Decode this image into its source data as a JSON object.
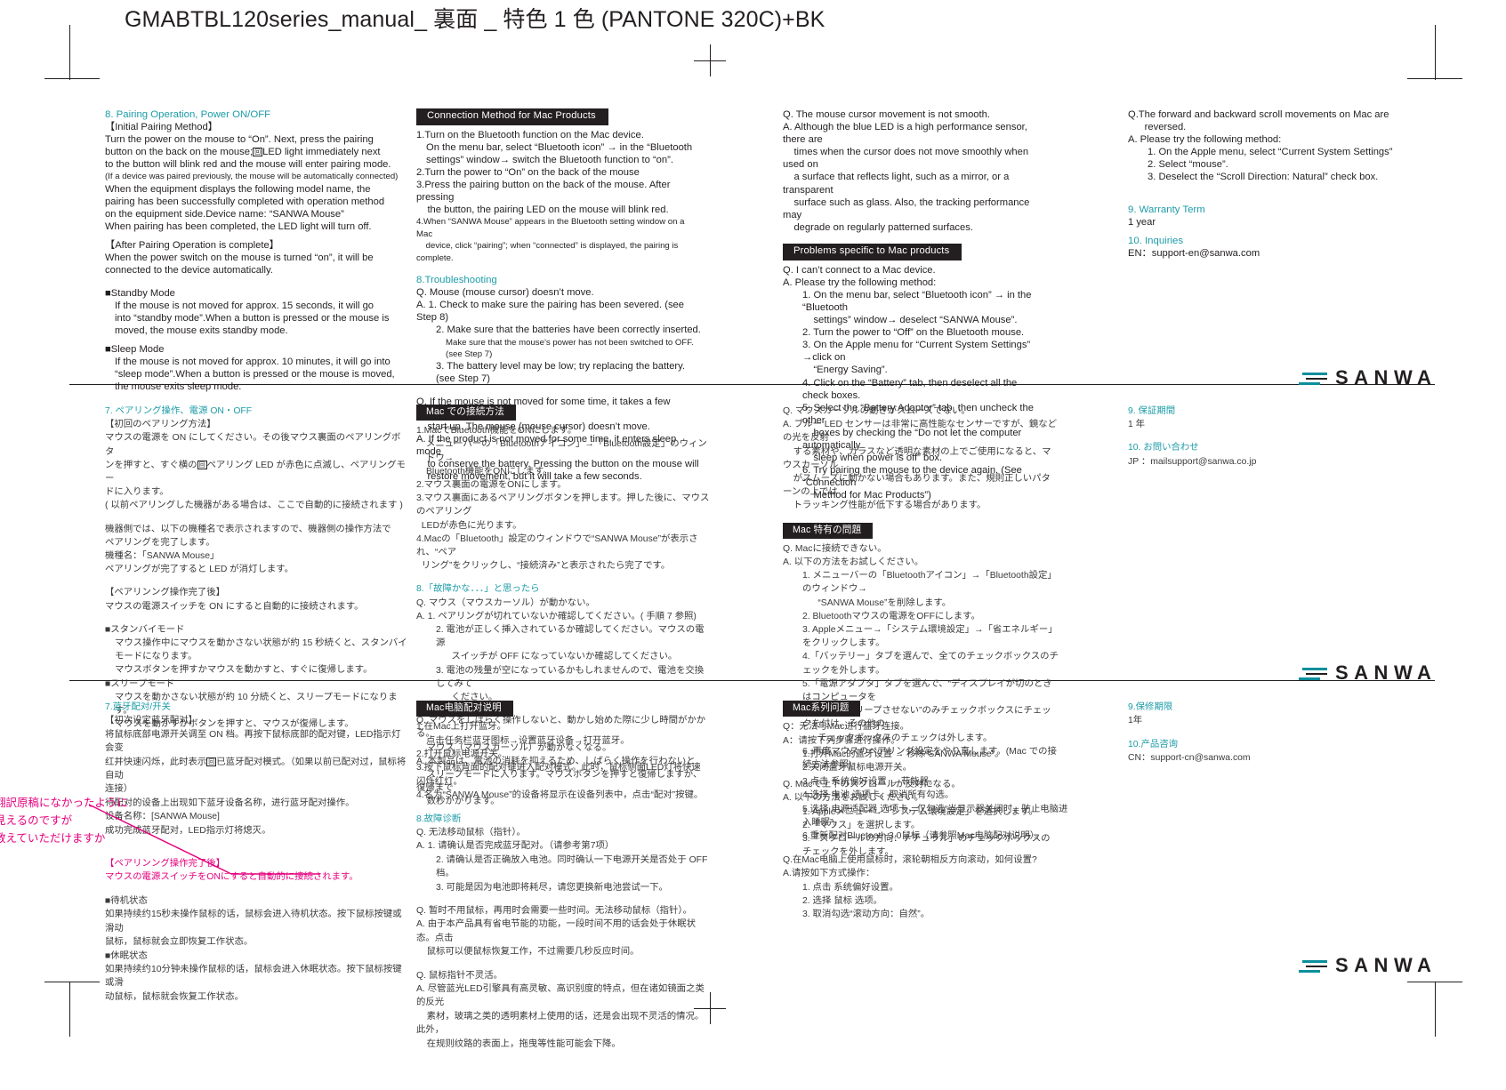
{
  "page": {
    "title": "GMABTBL120series_manual_ 裏面 _ 特色 1 色 (PANTONE 320C)+BK",
    "accent_teal": "#1d9ca8",
    "accent_pink": "#e5007e",
    "ink_black": "#231f20"
  },
  "logo": {
    "word": "SANWA",
    "mark": "sanwa-bars-mark"
  },
  "english": {
    "col1": {
      "heading": "8. Pairing Operation, Power ON/OFF",
      "sub1": "【Initial Pairing Method】",
      "p1_a": "Turn the power on the mouse to “On”. Next, press the pairing\nbutton on the back on the mouse;",
      "p1_glyph": "回",
      "p1_b": "LED light immediately next\nto the button will blink red and the mouse will enter pairing mode.",
      "p1_small": "(If a device was paired previously, the mouse will be automatically connected)",
      "p1_c": "When the equipment displays the following model name, the\npairing has been successfully completed with operation method\non the equipment side.Device name: “SANWA Mouse”\nWhen pairing has been completed, the LED light will turn off.",
      "sub2": "【After Pairing Operation is complete】",
      "p2": "When the power switch on the mouse is turned “on”, it will be\nconnected to the device automatically.",
      "standby_head": "■Standby Mode",
      "standby_body": "If the mouse is not moved for approx. 15 seconds, it will go\ninto “standby mode”.When a button is pressed or the mouse is\nmoved, the mouse exits standby mode.",
      "sleep_head": "■Sleep Mode",
      "sleep_body": "If the mouse is not moved for approx. 10 minutes, it will go into\n“sleep mode”.When a button is pressed or the mouse is moved,\nthe mouse exits sleep mode."
    },
    "col2": {
      "bar": "Connection Method for Mac Products",
      "step1": "1.Turn on the Bluetooth function on the Mac device.",
      "step1b": "On the menu bar, select “Bluetooth icon” → in the “Bluetooth\nsettings” window→ switch the Bluetooth function to “on”.",
      "step2": "2.Turn the power to “On” on the back of the mouse",
      "step3": "3.Press the pairing button on the back of the mouse. After pressing\n    the button, the pairing LED on the mouse will blink red.",
      "step4": "4.When “SANWA Mouse” appears in the Bluetooth setting window on a Mac\n    device, click “pairing”; when “connected” is displayed, the pairing is complete.",
      "heading2": "8.Troubleshooting",
      "q1": "Q. Mouse (mouse cursor) doesn’t move.",
      "a1_1": "A. 1. Check to make sure the pairing has been severed. (see Step 8)",
      "a1_2": "2. Make sure that the batteries have been correctly inserted.",
      "a1_2b": "Make sure that the mouse’s power has not been switched to OFF. (see Step 7)",
      "a1_3": "3. The battery level may be low; try replacing the battery. (see Step 7)",
      "q2": "Q. If the mouse is not moved for some time, it takes a few moments to\n    start up. The mouse (mouse cursor) doesn’t move.",
      "a2": "A. If the product is not moved for some time, it enters sleep mode\n    to conserve the battery. Pressing the button on the mouse will\n    restore movement, but it will take a few seconds."
    },
    "col3": {
      "q1": "Q. The mouse cursor movement is not smooth.",
      "a1": "A. Although the blue LED is a high performance sensor, there are\n    times when the cursor does not move smoothly when used on\n    a surface that reflects light, such as a mirror, or a transparent\n    surface such as glass. Also, the tracking performance may\n    degrade on regularly patterned surfaces.",
      "bar": "Problems specific to Mac products",
      "q2": "Q. I can’t connect to a Mac device.",
      "a2": "A. Please try the following method:",
      "a2_1": "1. On the menu bar, select “Bluetooth icon” → in the “Bluetooth\n    settings” window→ deselect “SANWA Mouse”.",
      "a2_2": "2. Turn the power to “Off” on the Bluetooth mouse.",
      "a2_3": "3. On the Apple menu for “Current System Settings” →click on\n    “Energy Saving”.",
      "a2_4": "4. Click on the “Battery” tab, then deselect all the check boxes.",
      "a2_5": "5. Select the “Battery Adaptor” tab, then uncheck the other\n    boxes by checking the “Do not let the computer automatically\n    sleep when power is off” box.",
      "a2_6": "6. Try pairing the mouse to the device again. (See “Connection\n    Method for Mac Products”)"
    },
    "col4": {
      "q1": "Q.The forward and backward scroll movements on Mac are\n      reversed.",
      "a1": "A. Please try the following method:",
      "a1_1": "1. On the Apple menu, select “Current System Settings”",
      "a1_2": "2. Select “mouse”.",
      "a1_3": "3. Deselect the “Scroll Direction: Natural” check box.",
      "warranty_head": "9. Warranty Term",
      "warranty_body": "1 year",
      "inquiries_head": "10. Inquiries",
      "inquiries_body": "EN：support-en@sanwa.com"
    }
  },
  "japanese": {
    "col1": {
      "heading": "7. ペアリング操作、電源 ON・OFF",
      "sub1": "【初回のペアリング方法】",
      "p1_a": "マウスの電源を ON にしてください。その後マウス裏面のペアリングボタ\nンを押すと、すぐ横の",
      "p1_glyph": "回",
      "p1_b": "ペアリング LED が赤色に点滅し、ペアリングモー\nドに入ります。",
      "p1_c": "( 以前ペアリングした機器がある場合は、ここで自動的に接続されます )",
      "p2": "機器側では、以下の機種名で表示されますので、機器側の操作方法で\nペアリングを完了します。\n機種名：「SANWA Mouse」\nペアリングが完了すると LED が消灯します。",
      "sub2": "【ペアリンング操作完了後】",
      "p3": "マウスの電源スイッチを ON にすると自動的に接続されます。",
      "standby_head": "■スタンバイモード",
      "standby_body": "マウス操作中にマウスを動かさない状態が約 15 秒続くと、スタンバイ\nモードになります。\nマウスボタンを押すかマウスを動かすと、すぐに復帰します。",
      "sleep_head": "■スリープモード",
      "sleep_body": "マウスを動かさない状態が約 10 分続くと、スリープモードになります。\nマウスを動かすかボタンを押すと、マウスが復帰します。"
    },
    "col2": {
      "bar": "Mac での接続方法",
      "step1": "1.MacでBluetooth機能をONにします。",
      "step1b": "メニューバーの「Bluetoothアイコン」→「Bluetooth設定」のウィンドウ→\nBluetooth機能をONにします。",
      "step2": "2.マウス裏面の電源をONにします。",
      "step3": "3.マウス裏面にあるペアリングボタンを押します。押した後に、マウスのペアリング\n  LEDが赤色に光ります。",
      "step4": "4.Macの「Bluetooth」設定のウィンドウで“SANWA Mouse”が表示され、“ペア\n  リング”をクリックし、“接続済み”と表示されたら完了です。",
      "heading2": "8.「故障かな．．．」と思ったら",
      "q1": "Q. マウス（マウスカーソル）が動かない。",
      "a1_1": "A. 1. ペアリングが切れていないか確認してください。( 手順 7 参照)",
      "a1_2": "2. 電池が正しく挿入されているか確認してください。マウスの電源\n      スイッチが OFF になっていないか確認してください。",
      "a1_3": "3. 電池の残量が空になっているかもしれませんので、電池を交換してみて\n      ください。",
      "q2": "Q. マウスをしばらく操作しないと、動かし始めた際に少し時間がかかる。\n    マウス（マウスカーソル）が動かなくなる。",
      "a2": "A. 本製品は、電池の消耗を抑えるため、しばらく操作を行わないと\n    スリープモードに入ります。マウスボタンを押すと復帰しますが、復帰まで\n    数秒かかります。"
    },
    "col3": {
      "q1": "Q. マウスカーソルの動きがスムーズでない。",
      "a1": "A. ブルー LED センサーは非常に高性能なセンサーですが、鏡などの光を反射\n    する素材や、ガラスなど透明な素材の上でご使用になると、マウスカーソル\n    がスムーズに動かない場合もあります。また、規則正しいパターンの上では\n    トラッキング性能が低下する場合があります。",
      "bar": "Mac 特有の問題",
      "q2": "Q. Macに接続できない。",
      "a2": "A. 以下の方法をお試しください。",
      "a2_1": "1. メニューバーの「Bluetoothアイコン」→「Bluetooth設定」のウィンドウ→\n      “SANWA Mouse”を削除します。",
      "a2_2": "2. Bluetoothマウスの電源をOFFにします。",
      "a2_3": "3. Appleメニュー→「システム環境設定」→「省エネルギー」をクリックします。",
      "a2_4": "4.「バッテリー」タブを選んで、全てのチェックボックスのチェックを外します。",
      "a2_5": "5.「電源アダプタ」タブを選んで、“ディスプレイが切のときはコンピュータを\n      自動でスリープさせない”のみチェックボックスにチェックを付け、その他の\n      チェックボックスのチェックは外します。",
      "a2_6": "6. 再度マウスのペアリング設定をやり直します。(Mac での接続方法参照)",
      "q3": "Q. Macで上下のスクロールが反対になる。",
      "a3": "A. 以下の方法をお試しください。",
      "a3_1": "1. Appleメニュー→「システム環境設定」を選択します。",
      "a3_2": "2.「マウス」を選択します。",
      "a3_3": "3.「スクロールの方向：ナチュラル」のチェックボックスのチェックを外します。"
    },
    "col4": {
      "warranty_head": "9. 保証期間",
      "warranty_body": "1 年",
      "inquiries_head": "10. お問い合わせ",
      "inquiries_body": "JP ：mailsupport@sanwa.co.jp"
    }
  },
  "chinese": {
    "col1": {
      "heading": "7.蓝牙配对/开关",
      "sub1": "【初次设定蓝牙配对】",
      "p1_a": "将鼠标底部电源开关调至 ON 档。再按下鼠标底部的配对键，LED指示灯会变\n红并快速闪烁，此时表示",
      "p1_glyph": "回",
      "p1_b": "已蓝牙配对模式。（如果以前已配对过，鼠标将自动\n连接）",
      "p1_c": "待配对的设备上出现如下蓝牙设备名称，进行蓝牙配对操作。\n设备名称：[SANWA Mouse]\n成功完成蓝牙配对，LED指示灯将熄灭。",
      "pink_head": "【ペアリンング操作完了後】",
      "pink_body": "マウスの電源スイッチをONにすると自動的に接続されます。",
      "standby_head": "■待机状态",
      "standby_body": "如果持续约15秒未操作鼠标的话，鼠标会进入待机状态。按下鼠标按键或滑动\n鼠标，鼠标就会立即恢复工作状态。",
      "sleep_head": "■休眠状态",
      "sleep_body": "如果持续约10分钟未操作鼠标的话，鼠标会进入休眠状态。按下鼠标按键或滑\n动鼠标，鼠标就会恢复工作状态。"
    },
    "col2": {
      "bar": "Mac电脑配对说明",
      "step1": "1.在Mac上打开蓝牙。",
      "step1b": "点击任务栏蓝牙图标→设置蓝牙设备→打开蓝牙。",
      "step2": "2.打开鼠标电源开关。",
      "step3": "3.按下鼠标背面的配对键进入配对模式。此时，鼠标侧面LED灯将快速闪烁红灯。",
      "step4": "4.名为“SANWA Mouse”的设备将显示在设备列表中，点击“配对”按键。",
      "heading2": "8.故障诊断",
      "q1": "Q. 无法移动鼠标（指针）。",
      "a1_1": "A. 1. 请确认是否完成蓝牙配对。（请参考第7项）",
      "a1_2": "2. 请确认是否正确放入电池。同时确认一下电源开关是否处于 OFF 档。",
      "a1_3": "3. 可能是因为电池即将耗尽，请您更换新电池尝试一下。",
      "q2": "Q. 暂时不用鼠标，再用时会需要一些时间。无法移动鼠标（指针）。",
      "a2": "A. 由于本产品具有省电节能的功能，一段时间不用的话会处于休眠状态。点击\n    鼠标可以便鼠标恢复工作，不过需要几秒反应时间。",
      "q3": "Q. 鼠标指针不灵活。",
      "a3": "A. 尽管蓝光LED引擎具有高灵敏、高识别度的特点，但在诸如镜面之类的反光\n    素材，玻璃之类的透明素材上使用的话，还是会出现不灵活的情况。此外，\n    在规则纹路的表面上，拖曳等性能可能会下降。"
    },
    "col3": {
      "bar": "Mac系列问题",
      "q1": "Q：无法与Mac进行蓝牙连接。",
      "a1": "A：请按下列步骤进行操作。",
      "a1_1": "1.打开Mac的蓝牙设置 → 移除“SANWA Mouse”。",
      "a1_2": "2.关闭蓝牙鼠标电源开关。",
      "a1_3": "3.点击 系统偏好设置 → 节能器。",
      "a1_4": "4.选择 电池 选项卡，取消所有勾选。",
      "a1_5": "5.选择 电源适配器 选项卡，仅勾选“当显示器关闭时，防止电脑进入睡眠”。",
      "a1_6": "6.重新配对Bluetooth 3.0鼠标（请参照Mac电脑配对说明）。",
      "q2": "Q.在Mac电脑上使用鼠标时，滚轮朝相反方向滚动，如何设置?",
      "a2": "A.请按如下方式操作：",
      "a2_1": "1. 点击 系统偏好设置。",
      "a2_2": "2. 选择 鼠标 选项。",
      "a2_3": "3. 取消勾选“滚动方向：自然”。"
    },
    "col4": {
      "warranty_head": "9.保修期限",
      "warranty_body": "1年",
      "inquiries_head": "10.产品咨询",
      "inquiries_body": "CN：support-cn@sanwa.com"
    }
  },
  "annotation": {
    "text": "翻訳原稿になかったように\n見えるのですが\n教えていただけますか",
    "color": "#e5007e"
  }
}
